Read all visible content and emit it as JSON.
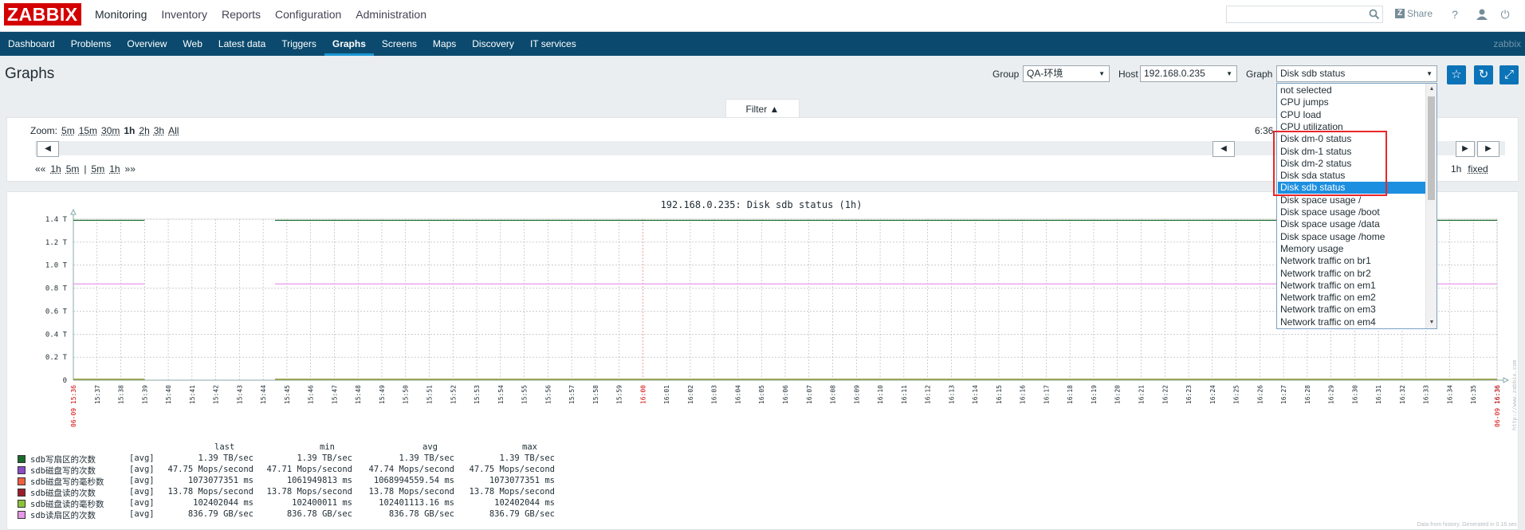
{
  "app": {
    "logo": "ZABBIX"
  },
  "main_menu": [
    "Monitoring",
    "Inventory",
    "Reports",
    "Configuration",
    "Administration"
  ],
  "topbar": {
    "share_label": "Share",
    "help_icon": "?",
    "power_icon": "⏻"
  },
  "sub_menu": [
    "Dashboard",
    "Problems",
    "Overview",
    "Web",
    "Latest data",
    "Triggers",
    "Graphs",
    "Screens",
    "Maps",
    "Discovery",
    "IT services"
  ],
  "sub_menu_active": "Graphs",
  "user": "zabbix",
  "page": {
    "title": "Graphs",
    "group_label": "Group",
    "group_value": "QA-环境",
    "host_label": "Host",
    "host_value": "192.168.0.235",
    "graph_label": "Graph",
    "graph_value": "Disk sdb status"
  },
  "filter": {
    "tab_label": "Filter ▲",
    "zoom_label": "Zoom:",
    "zoom_options": [
      "5m",
      "15m",
      "30m",
      "1h",
      "2h",
      "3h",
      "All"
    ],
    "zoom_selected": "1h",
    "period_left": [
      "««",
      "1h",
      "5m",
      "|",
      "5m",
      "1h",
      "»»"
    ],
    "now_text": "6:36 (now!)",
    "period_right": [
      "1h",
      "fixed"
    ]
  },
  "graph_dropdown": {
    "options": [
      "not selected",
      "CPU jumps",
      "CPU load",
      "CPU utilization",
      "Disk dm-0 status",
      "Disk dm-1 status",
      "Disk dm-2 status",
      "Disk sda status",
      "Disk sdb status",
      "Disk space usage /",
      "Disk space usage /boot",
      "Disk space usage /data",
      "Disk space usage /home",
      "Memory usage",
      "Network traffic on br1",
      "Network traffic on br2",
      "Network traffic on em1",
      "Network traffic on em2",
      "Network traffic on em3",
      "Network traffic on em4"
    ],
    "selected": "Disk sdb status"
  },
  "chart_data": {
    "type": "line",
    "title": "192.168.0.235: Disk sdb status (1h)",
    "y_ticks": [
      "0",
      "0.2 T",
      "0.4 T",
      "0.6 T",
      "0.8 T",
      "1.0 T",
      "1.2 T",
      "1.4 T"
    ],
    "ylim": [
      0,
      1.4
    ],
    "x_start_label": "06-09 15:36",
    "x_end_label": "06-09 16:36",
    "x_tick_labels": [
      "15:37",
      "15:38",
      "15:39",
      "15:40",
      "15:41",
      "15:42",
      "15:43",
      "15:44",
      "15:45",
      "15:46",
      "15:47",
      "15:48",
      "15:49",
      "15:50",
      "15:51",
      "15:52",
      "15:53",
      "15:54",
      "15:55",
      "15:56",
      "15:57",
      "15:58",
      "15:59",
      "16:00",
      "16:01",
      "16:02",
      "16:03",
      "16:04",
      "16:05",
      "16:06",
      "16:07",
      "16:08",
      "16:09",
      "16:10",
      "16:11",
      "16:12",
      "16:13",
      "16:14",
      "16:15",
      "16:16",
      "16:17",
      "16:18",
      "16:19",
      "16:20",
      "16:21",
      "16:22",
      "16:23",
      "16:24",
      "16:25",
      "16:26",
      "16:27",
      "16:28",
      "16:29",
      "16:30",
      "16:31",
      "16:32",
      "16:33",
      "16:34",
      "16:35",
      "16:36"
    ],
    "highlight_tick": "16:00",
    "gap_minutes": [
      3.0,
      8.5
    ],
    "legend_headers": [
      "last",
      "min",
      "avg",
      "max"
    ],
    "series": [
      {
        "name": "sdb写扇区的次数",
        "color": "#1a6b2b",
        "fn": "[avg]",
        "last": "1.39 TB/sec",
        "min": "1.39 TB/sec",
        "avg": "1.39 TB/sec",
        "max": "1.39 TB/sec",
        "level": 1.39
      },
      {
        "name": "sdb磁盘写的次数",
        "color": "#8b4cc8",
        "fn": "[avg]",
        "last": "47.75 Mops/second",
        "min": "47.71 Mops/second",
        "avg": "47.74 Mops/second",
        "max": "47.75 Mops/second",
        "level": 4.77e-05
      },
      {
        "name": "sdb磁盘写的毫秒数",
        "color": "#f06040",
        "fn": "[avg]",
        "last": "1073077351 ms",
        "min": "1061949813 ms",
        "avg": "1068994559.54 ms",
        "max": "1073077351 ms",
        "level": 0.0011
      },
      {
        "name": "sdb磁盘读的次数",
        "color": "#9b1f2a",
        "fn": "[avg]",
        "last": "13.78 Mops/second",
        "min": "13.78 Mops/second",
        "avg": "13.78 Mops/second",
        "max": "13.78 Mops/second",
        "level": 1.38e-05
      },
      {
        "name": "sdb磁盘读的毫秒数",
        "color": "#8cc23a",
        "fn": "[avg]",
        "last": "102402044 ms",
        "min": "102400011 ms",
        "avg": "102401113.16 ms",
        "max": "102402044 ms",
        "level": 0.0001
      },
      {
        "name": "sdb读扇区的次数",
        "color": "#e898e8",
        "fn": "[avg]",
        "last": "836.79 GB/sec",
        "min": "836.78 GB/sec",
        "avg": "836.78 GB/sec",
        "max": "836.79 GB/sec",
        "level": 0.837
      }
    ]
  },
  "watermark": "http://www.zabbix.com",
  "footnote": "Data from history. Generated in 0.16 sec"
}
